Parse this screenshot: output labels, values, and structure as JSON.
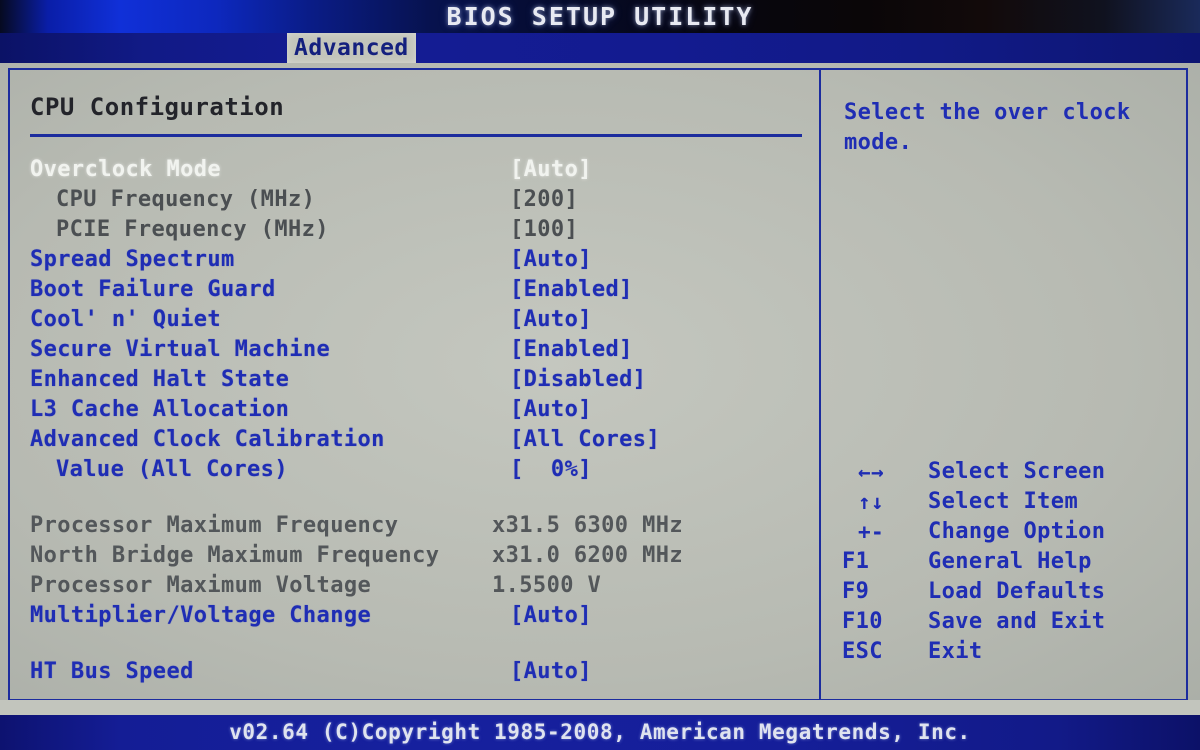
{
  "header": {
    "title": "BIOS SETUP UTILITY",
    "tabs": [
      {
        "label": "Advanced",
        "active": true
      }
    ]
  },
  "left_panel": {
    "section_title": "CPU Configuration",
    "options": [
      {
        "label": "Overclock Mode",
        "value": "[Auto]",
        "state": "selected",
        "indent": false
      },
      {
        "label": "CPU Frequency  (MHz)",
        "value": "[200]",
        "state": "disabled",
        "indent": true
      },
      {
        "label": "PCIE Frequency  (MHz)",
        "value": "[100]",
        "state": "disabled",
        "indent": true
      },
      {
        "label": "Spread Spectrum",
        "value": "[Auto]",
        "state": "normal",
        "indent": false
      },
      {
        "label": "Boot Failure Guard",
        "value": "[Enabled]",
        "state": "normal",
        "indent": false
      },
      {
        "label": "Cool' n' Quiet",
        "value": "[Auto]",
        "state": "normal",
        "indent": false
      },
      {
        "label": "Secure Virtual Machine",
        "value": "[Enabled]",
        "state": "normal",
        "indent": false
      },
      {
        "label": "Enhanced Halt State",
        "value": "[Disabled]",
        "state": "normal",
        "indent": false
      },
      {
        "label": "L3 Cache Allocation",
        "value": "[Auto]",
        "state": "normal",
        "indent": false
      },
      {
        "label": "Advanced Clock Calibration",
        "value": "[All Cores]",
        "state": "normal",
        "indent": false
      },
      {
        "label": "Value (All Cores)",
        "value": "[  0%]",
        "state": "normal",
        "indent": true
      }
    ],
    "info_rows": [
      {
        "label": "Processor Maximum Frequency",
        "value": "x31.5 6300 MHz",
        "state": "info"
      },
      {
        "label": "North Bridge Maximum Frequency",
        "value": "x31.0 6200 MHz",
        "state": "info"
      },
      {
        "label": "Processor Maximum Voltage",
        "value": "1.5500 V",
        "state": "info"
      }
    ],
    "trailing_options": [
      {
        "label": "Multiplier/Voltage Change",
        "value": "[Auto]",
        "state": "normal",
        "indent": false
      },
      {
        "label": "HT Bus Speed",
        "value": "[Auto]",
        "state": "normal",
        "indent": false
      }
    ]
  },
  "right_panel": {
    "help_text": "Select the over clock mode.",
    "legend": [
      {
        "key": "←→",
        "desc": "Select Screen",
        "symbol": true
      },
      {
        "key": "↑↓",
        "desc": "Select Item",
        "symbol": true
      },
      {
        "key": "+-",
        "desc": "Change Option",
        "symbol": true
      },
      {
        "key": "F1",
        "desc": "General Help",
        "symbol": false
      },
      {
        "key": "F9",
        "desc": "Load Defaults",
        "symbol": false
      },
      {
        "key": "F10",
        "desc": "Save and Exit",
        "symbol": false
      },
      {
        "key": "ESC",
        "desc": "Exit",
        "symbol": false
      }
    ]
  },
  "footer": {
    "text": "v02.64 (C)Copyright 1985-2008, American Megatrends, Inc."
  },
  "colors": {
    "background": "#b9bcb4",
    "accent_blue": "#1f2db4",
    "border_blue": "#1c2c9e",
    "selected_text": "#f1f3ef",
    "disabled_text": "#4b4f52",
    "title_bar_blue": "#1030d8",
    "footer_blue": "#16209e"
  }
}
